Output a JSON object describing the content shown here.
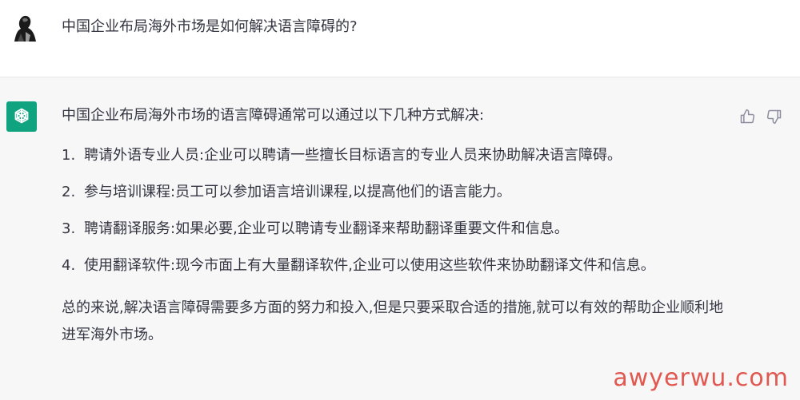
{
  "user_message": {
    "text": "中国企业布局海外市场是如何解决语言障碍的?"
  },
  "assistant_message": {
    "intro": "中国企业布局海外市场的语言障碍通常可以通过以下几种方式解决:",
    "items": [
      {
        "num": "1.",
        "text": "聘请外语专业人员:企业可以聘请一些擅长目标语言的专业人员来协助解决语言障碍。"
      },
      {
        "num": "2.",
        "text": "参与培训课程:员工可以参加语言培训课程,以提高他们的语言能力。"
      },
      {
        "num": "3.",
        "text": "聘请翻译服务:如果必要,企业可以聘请专业翻译来帮助翻译重要文件和信息。"
      },
      {
        "num": "4.",
        "text": "使用翻译软件:现今市面上有大量翻译软件,企业可以使用这些软件来协助翻译文件和信息。"
      }
    ],
    "summary": "总的来说,解决语言障碍需要多方面的努力和投入,但是只要采取合适的措施,就可以有效的帮助企业顺利地进军海外市场。"
  },
  "watermark": {
    "text": "awyerwu.com",
    "color": "#dc3c32"
  },
  "icons": {
    "user_avatar": "user-avatar",
    "gpt_logo": "openai-logo-icon",
    "thumbs_up": "thumbs-up-icon",
    "thumbs_down": "thumbs-down-icon"
  },
  "colors": {
    "assistant_bg": "#f7f7f8",
    "gpt_green": "#10a37f",
    "text": "#343541"
  }
}
